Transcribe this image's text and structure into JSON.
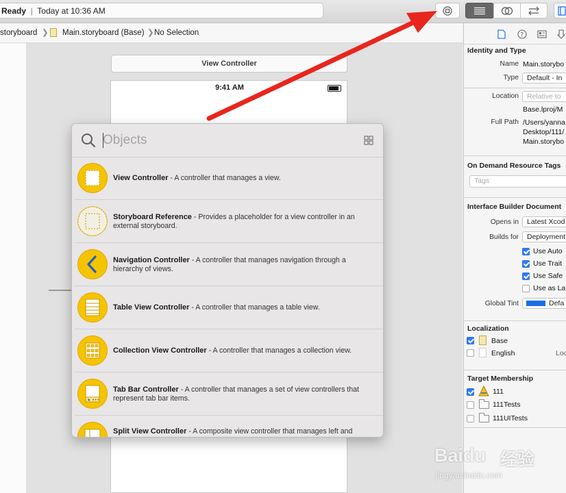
{
  "toolbar": {
    "status_prefix": "Ready",
    "status_time": "Today at 10:36 AM"
  },
  "breadcrumb": {
    "item1": "storyboard",
    "item2": "Main.storyboard (Base)",
    "item3": "No Selection"
  },
  "canvas": {
    "scene_title": "View Controller",
    "status_bar_time": "9:41 AM"
  },
  "library": {
    "search_placeholder": "Objects",
    "items": [
      {
        "title": "View Controller",
        "desc": " - A controller that manages a view.",
        "icon": "view-controller-icon"
      },
      {
        "title": "Storyboard Reference",
        "desc": " - Provides a placeholder for a view controller in an external storyboard.",
        "icon": "storyboard-reference-icon"
      },
      {
        "title": "Navigation Controller",
        "desc": " - A controller that manages navigation through a hierarchy of views.",
        "icon": "navigation-controller-icon"
      },
      {
        "title": "Table View Controller",
        "desc": " - A controller that manages a table view.",
        "icon": "table-view-controller-icon"
      },
      {
        "title": "Collection View Controller",
        "desc": " - A controller that manages a collection view.",
        "icon": "collection-view-controller-icon"
      },
      {
        "title": "Tab Bar Controller",
        "desc": " - A controller that manages a set of view controllers that represent tab bar items.",
        "icon": "tab-bar-controller-icon"
      },
      {
        "title": "Split View Controller",
        "desc": " - A composite view controller that manages left and",
        "icon": "split-view-controller-icon"
      }
    ]
  },
  "inspector": {
    "identity_header": "Identity and Type",
    "name_label": "Name",
    "name_value": "Main.storybo",
    "type_label": "Type",
    "type_value": "Default - In",
    "location_label": "Location",
    "location_value": "Relative to",
    "location_path": "Base.lproj/M",
    "fullpath_label": "Full Path",
    "fullpath_line1": "/Users/yanna",
    "fullpath_line2": "Desktop/111/",
    "fullpath_line3": "Main.storybo",
    "odr_header": "On Demand Resource Tags",
    "tags_placeholder": "Tags",
    "ibdoc_header": "Interface Builder Document",
    "opens_in_label": "Opens in",
    "opens_in_value": "Latest Xcod",
    "builds_for_label": "Builds for",
    "builds_for_value": "Deployment",
    "opt_auto": "Use Auto",
    "opt_trait": "Use Trait",
    "opt_safe": "Use Safe",
    "opt_as_la": "Use as La",
    "global_tint_label": "Global Tint",
    "global_tint_value": "Defa",
    "tint_color": "#1a6ee8",
    "localization_header": "Localization",
    "loc_base": "Base",
    "loc_english": "English",
    "loc_right": "Loc",
    "target_header": "Target Membership",
    "target_1": "111",
    "target_2": "111Tests",
    "target_3": "111UITests"
  },
  "watermark": {
    "text_main": "Baidu",
    "text_cn": "经验",
    "text_url": "jingyan.baidu.com"
  },
  "colors": {
    "annotation_arrow": "#e8261e",
    "accent": "#2f7cf6",
    "library_icon": "#f5c400"
  }
}
